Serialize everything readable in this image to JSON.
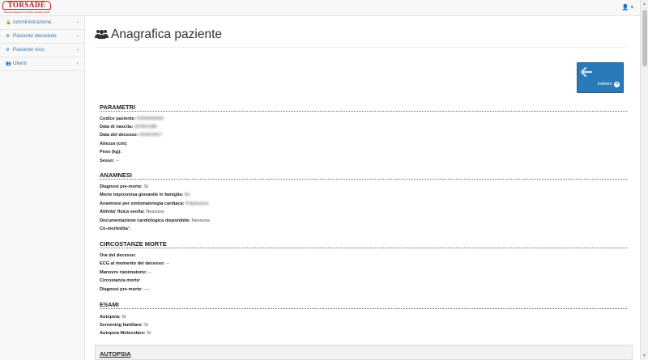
{
  "app": {
    "logo_title": "TORSADE",
    "logo_subtitle": "Toscana Registro di Sudden cardiac Death"
  },
  "topbar": {
    "user_icon": "user-icon",
    "user_caret": "▾"
  },
  "sidebar": {
    "items": [
      {
        "label": "Amministrazione",
        "icon": "lock-icon"
      },
      {
        "label": "Paziente deceduto",
        "icon": "gear-icon"
      },
      {
        "label": "Paziente vivo",
        "icon": "gear-icon"
      },
      {
        "label": "Utenti",
        "icon": "users-icon"
      }
    ]
  },
  "page": {
    "title": "Anagrafica paziente",
    "back_label": "Indietro"
  },
  "sections": {
    "parametri": {
      "title": "PARAMETRI",
      "rows": [
        {
          "k": "Codice paziente:",
          "v": "FI000000000"
        },
        {
          "k": "Data di nascita:",
          "v": "25/00/1980"
        },
        {
          "k": "Data del decesso:",
          "v": "00/00/2017"
        },
        {
          "k": "Altezza (cm):",
          "v": ""
        },
        {
          "k": "Peso (kg):",
          "v": ""
        },
        {
          "k": "Sesso:",
          "v": "--"
        }
      ]
    },
    "anamnesi": {
      "title": "ANAMNESI",
      "rows": [
        {
          "k": "Diagnosi pre-morte:",
          "v": "Si"
        },
        {
          "k": "Morte improvvisa giovanile in famiglia:",
          "v": "No"
        },
        {
          "k": "Anamnesi per sintomatologia cardiaca:",
          "v": "Palpitazioni"
        },
        {
          "k": "Attivita' fisica svolta:",
          "v": "Nessuna"
        },
        {
          "k": "Documentazione cardiologica disponibile:",
          "v": "Nessuna"
        },
        {
          "k": "Co-morbidita':",
          "v": ""
        }
      ]
    },
    "circostanze": {
      "title": "CIRCOSTANZE MORTE",
      "rows": [
        {
          "k": "Ora del decesso:",
          "v": ""
        },
        {
          "k": "ECG al momento del decesso:",
          "v": "--"
        },
        {
          "k": "Manovre rianimatorie:",
          "v": "--"
        },
        {
          "k": "Circostanza morte:",
          "v": ""
        },
        {
          "k": "Diagnosi pre-morte:",
          "v": "----"
        }
      ]
    },
    "esami": {
      "title": "ESAMI",
      "rows": [
        {
          "k": "Autopsia:",
          "v": "Si"
        },
        {
          "k": "Screening familiare:",
          "v": "Si"
        },
        {
          "k": "Autopsia Molecolare:",
          "v": "Si"
        }
      ]
    },
    "autopsia": {
      "title": "AUTOPSIA"
    }
  }
}
